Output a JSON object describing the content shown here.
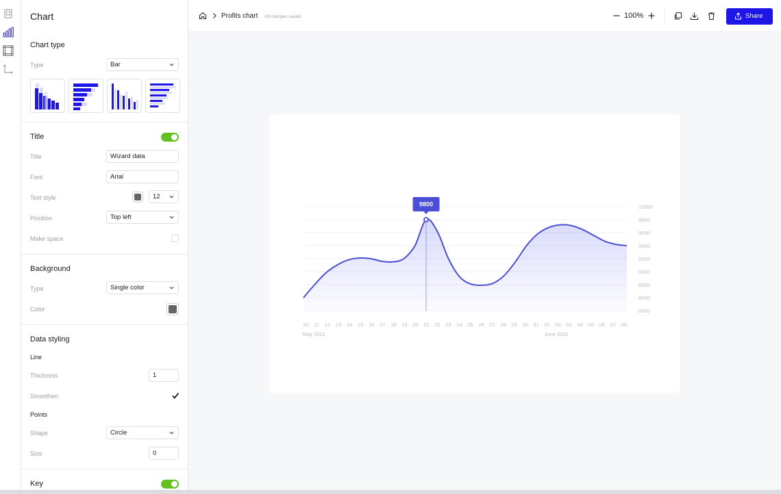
{
  "panel": {
    "title": "Chart",
    "chart_type": {
      "heading": "Chart type",
      "type_label": "Type",
      "type_value": "Bar",
      "thumbnails": [
        "bar-vertical",
        "bar-horizontal",
        "bar-grouped-vertical",
        "bar-grouped-horizontal"
      ]
    },
    "title_section": {
      "heading": "Title",
      "enabled": true,
      "title_label": "Title",
      "title_value": "Wizard data",
      "font_label": "Font",
      "font_value": "Arial",
      "text_style_label": "Text style",
      "text_color": "#666666",
      "text_size": "12",
      "position_label": "Position",
      "position_value": "Top left",
      "make_space_label": "Make space",
      "make_space_checked": false
    },
    "background": {
      "heading": "Background",
      "type_label": "Type",
      "type_value": "Single color",
      "color_label": "Color",
      "color_value": "#666666"
    },
    "data_styling": {
      "heading": "Data styling",
      "line_heading": "Line",
      "thickness_label": "Thickness",
      "thickness_value": "1",
      "smoothen_label": "Smoothen",
      "smoothen_checked": true,
      "points_heading": "Points",
      "shape_label": "Shape",
      "shape_value": "Circle",
      "size_label": "Size",
      "size_value": "0"
    },
    "key": {
      "heading": "Key",
      "enabled": true
    }
  },
  "topbar": {
    "chart_name": "Profits chart",
    "save_status": "All changes saved.",
    "zoom": "100%",
    "share_label": "Share"
  },
  "colors": {
    "accent": "#1d16e6",
    "toggle_on": "#62c11e",
    "line": "#4a4fcf",
    "tooltip": "#4a4fd6"
  },
  "chart_data": {
    "type": "area",
    "x": [
      "10",
      "11",
      "12",
      "13",
      "14",
      "15",
      "16",
      "17",
      "18",
      "19",
      "20",
      "21",
      "22",
      "23",
      "24",
      "25",
      "26",
      "27",
      "28",
      "29",
      "30",
      "31",
      "01",
      "02",
      "03",
      "04",
      "05",
      "06",
      "07",
      "08"
    ],
    "month_labels": [
      {
        "text": "May 2021",
        "at": "10"
      },
      {
        "text": "June 2021",
        "at": "01"
      }
    ],
    "series": [
      {
        "values": [
          8600,
          8800,
          8980,
          9100,
          9180,
          9210,
          9200,
          9160,
          9150,
          9200,
          9400,
          9800,
          9620,
          9200,
          8920,
          8810,
          8790,
          8820,
          8940,
          9150,
          9400,
          9580,
          9680,
          9720,
          9710,
          9650,
          9560,
          9470,
          9420,
          9400
        ]
      }
    ],
    "y_ticks": [
      8400,
      8600,
      8800,
      9000,
      9200,
      9400,
      9600,
      9800,
      10000
    ],
    "ylim": [
      8400,
      10000
    ],
    "y_axis_side": "right",
    "grid": true,
    "tooltip": {
      "x": "21",
      "value": "9800"
    }
  }
}
